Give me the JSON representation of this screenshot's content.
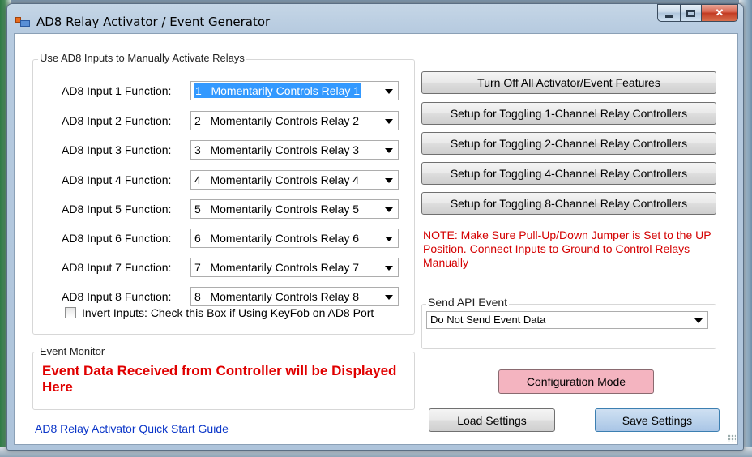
{
  "window": {
    "title": "AD8 Relay Activator / Event Generator"
  },
  "manual_group": {
    "label": "Use AD8 Inputs to Manually Activate Relays",
    "rows": [
      {
        "label": "AD8 Input 1 Function:",
        "value": "1   Momentarily Controls Relay 1"
      },
      {
        "label": "AD8 Input 2 Function:",
        "value": "2   Momentarily Controls Relay 2"
      },
      {
        "label": "AD8 Input 3 Function:",
        "value": "3   Momentarily Controls Relay 3"
      },
      {
        "label": "AD8 Input 4 Function:",
        "value": "4   Momentarily Controls Relay 4"
      },
      {
        "label": "AD8 Input 5 Function:",
        "value": "5   Momentarily Controls Relay 5"
      },
      {
        "label": "AD8 Input 6 Function:",
        "value": "6   Momentarily Controls Relay 6"
      },
      {
        "label": "AD8 Input 7 Function:",
        "value": "7   Momentarily Controls Relay 7"
      },
      {
        "label": "AD8 Input 8 Function:",
        "value": "8   Momentarily Controls Relay 8"
      }
    ],
    "invert_label": "Invert Inputs: Check this Box if Using KeyFob on AD8 Port",
    "invert_checked": false
  },
  "buttons": {
    "turn_off": "Turn Off All Activator/Event Features",
    "toggle_1": "Setup for Toggling 1-Channel Relay Controllers",
    "toggle_2": "Setup for Toggling 2-Channel Relay Controllers",
    "toggle_4": "Setup for Toggling 4-Channel Relay Controllers",
    "toggle_8": "Setup for Toggling 8-Channel Relay Controllers",
    "configuration_mode": "Configuration Mode",
    "load_settings": "Load Settings",
    "save_settings": "Save Settings"
  },
  "note": "NOTE: Make Sure Pull-Up/Down Jumper is Set to the UP Position.  Connect Inputs to Ground to Control Relays Manually",
  "api_event": {
    "label": "Send API Event",
    "value": "Do Not Send Event Data"
  },
  "event_monitor": {
    "label": "Event Monitor",
    "text": "Event Data Received from Controller will be Displayed Here"
  },
  "quick_start_link": "AD8 Relay Activator Quick Start Guide",
  "colors": {
    "note_red": "#d40000",
    "monitor_red": "#e00000",
    "config_pink": "#f4b4c0",
    "save_blue": "#bcd3ec",
    "selection_blue": "#3399ff",
    "link_blue": "#0a35c8"
  }
}
